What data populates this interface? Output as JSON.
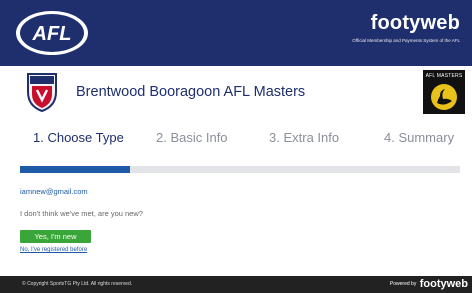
{
  "header": {
    "afl_logo_text": "AFL",
    "brand_name": "footyweb",
    "brand_tagline": "Official Membership and Payments System of the AFL"
  },
  "club": {
    "name": "Brentwood Booragoon AFL Masters",
    "masters_badge_text": "AFL MASTERS"
  },
  "steps": [
    {
      "label": "1. Choose Type",
      "active": true
    },
    {
      "label": "2. Basic Info",
      "active": false
    },
    {
      "label": "3. Extra Info",
      "active": false
    },
    {
      "label": "4. Summary",
      "active": false
    }
  ],
  "progress": {
    "fraction": 0.25,
    "fill_color": "#1f5aa6"
  },
  "body": {
    "email": "iamnew@gmail.com",
    "question": "I don't think we've met, are you new?",
    "new_button": "Yes, I'm new",
    "registered_link": "No, I've registered before"
  },
  "footer": {
    "copyright": "© Copyright SportsTG Pty Ltd. All rights reserved.",
    "powered_by": "Powered by",
    "powered_brand": "footyweb"
  },
  "colors": {
    "navy": "#1f2f6e",
    "accent_blue": "#1f5aa6",
    "green": "#3aa63a",
    "footer": "#222222"
  }
}
